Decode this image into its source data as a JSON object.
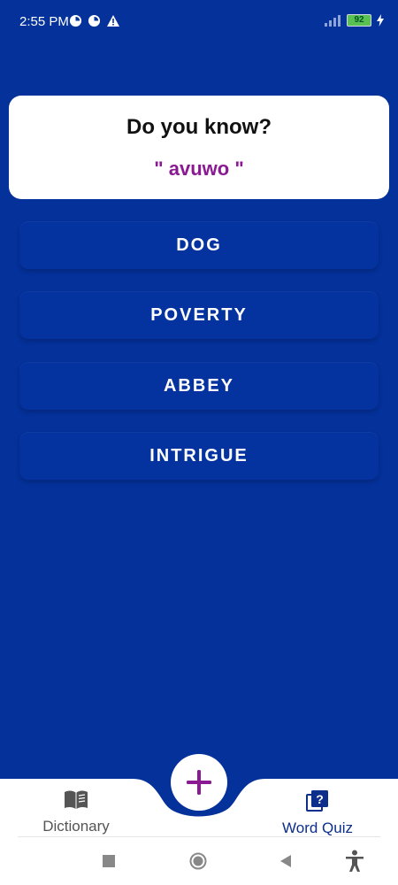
{
  "status_bar": {
    "time": "2:55 PM",
    "battery": "92"
  },
  "quiz": {
    "prompt": "Do you know?",
    "word": "\" avuwo \"",
    "options": [
      "DOG",
      "POVERTY",
      "ABBEY",
      "INTRIGUE"
    ]
  },
  "bottom_nav": {
    "dictionary_label": "Dictionary",
    "word_quiz_label": "Word Quiz",
    "fab_icon": "plus-icon"
  },
  "colors": {
    "background": "#04319a",
    "word": "#8a1a92",
    "active_nav": "#0d2f8c",
    "fab_plus": "#8a1a92"
  }
}
